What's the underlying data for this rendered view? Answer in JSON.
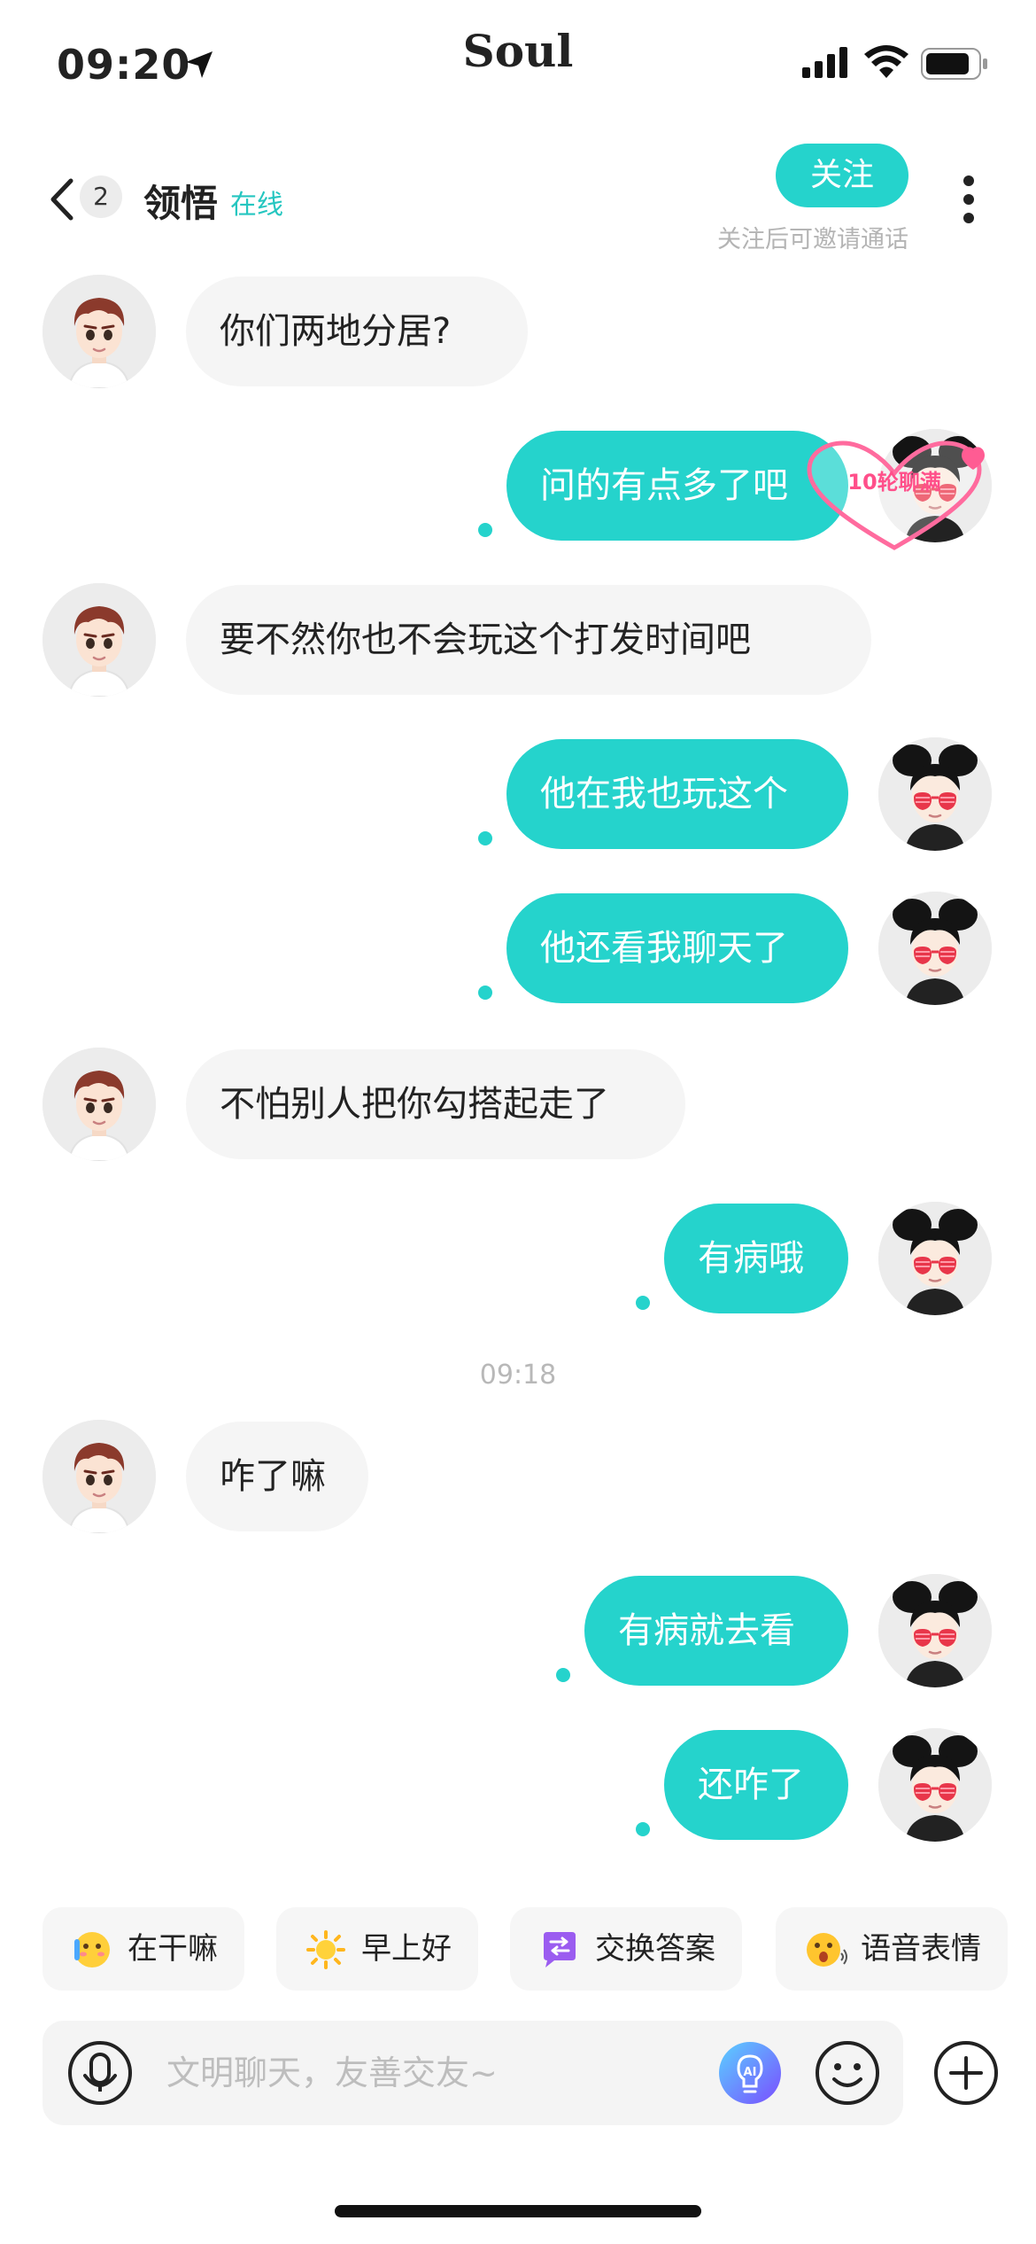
{
  "status_bar": {
    "time": "09:20",
    "app_name": "Soul"
  },
  "header": {
    "unread_count": "2",
    "contact_name": "领悟",
    "online_status": "在线",
    "follow_label": "关注",
    "follow_hint": "关注后可邀请通话"
  },
  "messages": [
    {
      "from": "them",
      "text": "你们两地分居?"
    },
    {
      "from": "me",
      "text": "问的有点多了吧"
    },
    {
      "from": "them",
      "text": "要不然你也不会玩这个打发时间吧"
    },
    {
      "from": "me",
      "text": "他在我也玩这个"
    },
    {
      "from": "me",
      "text": "他还看我聊天了"
    },
    {
      "from": "them",
      "text": "不怕别人把你勾搭起走了"
    },
    {
      "from": "me",
      "text": "有病哦"
    },
    {
      "from": "them",
      "text": "咋了嘛"
    },
    {
      "from": "me",
      "text": "有病就去看"
    },
    {
      "from": "me",
      "text": "还咋了"
    }
  ],
  "timestamp": "09:18",
  "intimacy_badge": "10轮聊满",
  "quick_replies": [
    {
      "icon": "blushing-face-icon",
      "label": "在干嘛"
    },
    {
      "icon": "sun-icon",
      "label": "早上好"
    },
    {
      "icon": "exchange-icon",
      "label": "交换答案"
    },
    {
      "icon": "voice-emoji-icon",
      "label": "语音表情"
    }
  ],
  "input": {
    "placeholder": "文明聊天，友善交友~",
    "value": ""
  },
  "colors": {
    "accent": "#25d3cc",
    "incoming_bubble": "#f5f5f5",
    "hint_text": "#b4b4b4"
  }
}
